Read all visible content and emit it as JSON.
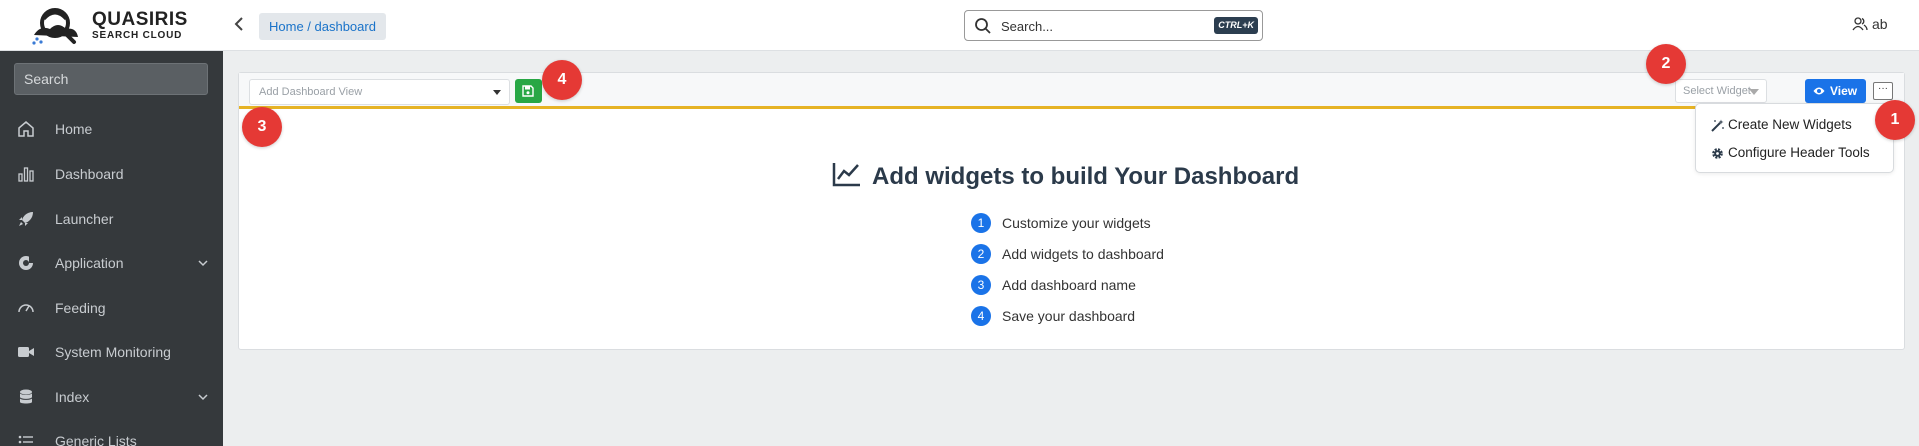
{
  "header": {
    "logo_line1": "QUASIRIS",
    "logo_line2": "SEARCH CLOUD",
    "breadcrumb": "Home / dashboard",
    "search_label": "Search...",
    "search_shortcut": "CTRL+K",
    "user_label": "ab"
  },
  "sidebar": {
    "search_placeholder": "Search",
    "items": [
      {
        "label": "Home",
        "icon": "home-icon"
      },
      {
        "label": "Dashboard",
        "icon": "bar-chart-icon"
      },
      {
        "label": "Launcher",
        "icon": "rocket-icon"
      },
      {
        "label": "Application",
        "icon": "app-icon",
        "expandable": true
      },
      {
        "label": "Feeding",
        "icon": "gauge-icon"
      },
      {
        "label": "System Monitoring",
        "icon": "video-icon"
      },
      {
        "label": "Index",
        "icon": "database-icon",
        "expandable": true
      },
      {
        "label": "Generic Lists",
        "icon": "list-icon"
      }
    ]
  },
  "toolbar": {
    "dashboard_placeholder": "Add Dashboard View",
    "widget_placeholder": "Select Widget",
    "view_label": "View",
    "more_label": "···"
  },
  "menu": {
    "items": [
      {
        "label": "Create New Widgets",
        "icon": "magic-wand-icon"
      },
      {
        "label": "Configure Header Tools",
        "icon": "gear-icon"
      }
    ]
  },
  "empty_state": {
    "title": "Add widgets to build Your Dashboard",
    "steps": [
      {
        "num": "1",
        "text": "Customize your widgets"
      },
      {
        "num": "2",
        "text": "Add widgets to dashboard"
      },
      {
        "num": "3",
        "text": "Add dashboard name"
      },
      {
        "num": "4",
        "text": "Save your dashboard"
      }
    ]
  },
  "markers": [
    "1",
    "2",
    "3",
    "4"
  ],
  "colors": {
    "sidebar_bg": "#35393c",
    "accent_blue": "#1a73e8",
    "save_green": "#28a745",
    "toolbar_border": "#e6b325",
    "marker_red": "#e53935"
  }
}
